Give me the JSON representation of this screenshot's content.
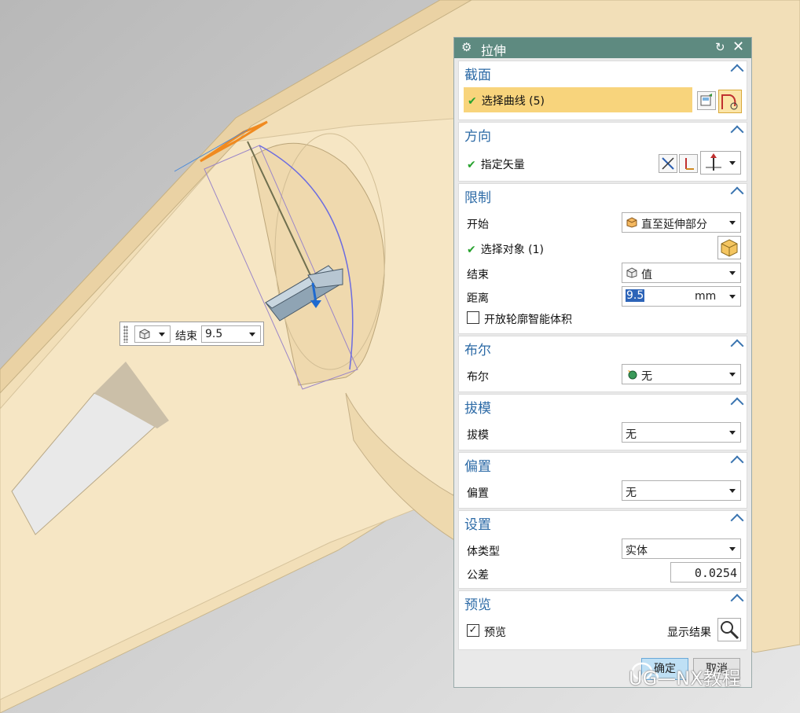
{
  "floating": {
    "end_label": "结束",
    "end_value": "9.5"
  },
  "dialog": {
    "title": "拉伸",
    "sections": {
      "section": {
        "title": "截面",
        "select_curve": "选择曲线 (5)"
      },
      "direction": {
        "title": "方向",
        "specify_vector": "指定矢量"
      },
      "limits": {
        "title": "限制",
        "start_label": "开始",
        "start_value": "直至延伸部分",
        "select_object": "选择对象 (1)",
        "end_label": "结束",
        "end_value": "值",
        "distance_label": "距离",
        "distance_value": "9.5",
        "distance_unit": "mm",
        "open_profile": "开放轮廓智能体积"
      },
      "boolean": {
        "title": "布尔",
        "label": "布尔",
        "value": "无"
      },
      "draft": {
        "title": "拔模",
        "label": "拔模",
        "value": "无"
      },
      "offset": {
        "title": "偏置",
        "label": "偏置",
        "value": "无"
      },
      "settings": {
        "title": "设置",
        "body_type_label": "体类型",
        "body_type_value": "实体",
        "tolerance_label": "公差",
        "tolerance_value": "0.0254"
      },
      "preview": {
        "title": "预览",
        "preview_label": "预览",
        "show_result_label": "显示结果"
      }
    },
    "ok_label": "确定",
    "cancel_label": "取消"
  },
  "watermark": "UG—NX教程",
  "colors": {
    "title_bar": "#5e8a80",
    "section_title": "#2c6aa6",
    "highlight": "#f8d47c",
    "model": "#f0dcb4"
  }
}
